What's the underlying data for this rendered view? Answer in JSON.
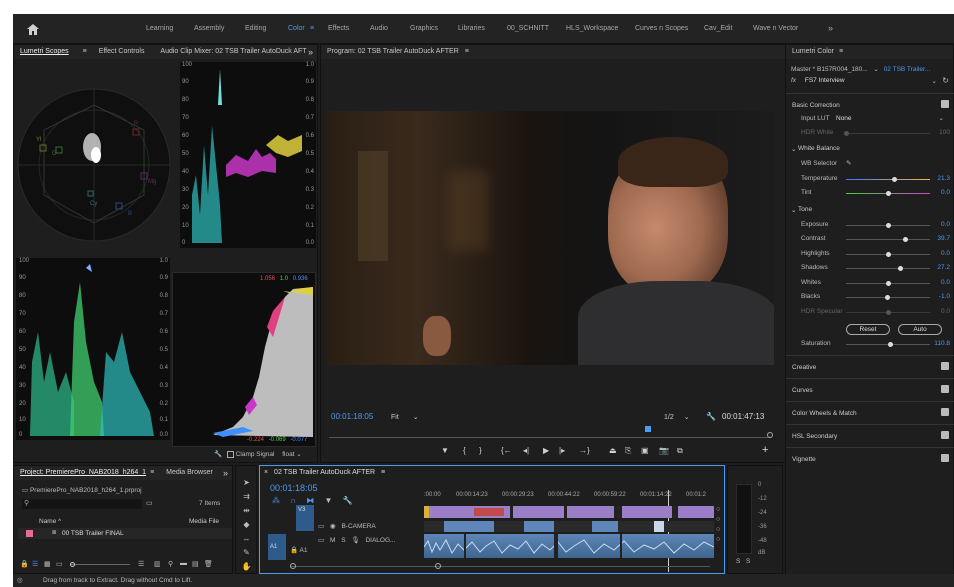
{
  "workspaces": [
    "Learning",
    "Assembly",
    "Editing",
    "Color",
    "Effects",
    "Audio",
    "Graphics",
    "Libraries",
    "00_SCHNITT",
    "HLS_Workspace",
    "Curves n Scopes",
    "Cav_Edit",
    "Wave n Vector"
  ],
  "active_workspace": "Color",
  "scopes_panel": {
    "tab_lumetri": "Lumetri Scopes",
    "tab_effect": "Effect Controls",
    "tab_mixer": "Audio Clip Mixer: 02 TSB Trailer AutoDuck AFT",
    "vector_labels": [
      "R",
      "Mg",
      "B",
      "Cy",
      "G",
      "Yl"
    ],
    "wave_ticks_left": [
      "100",
      "90",
      "80",
      "70",
      "60",
      "50",
      "40",
      "30",
      "20",
      "10",
      "0"
    ],
    "wave_ticks_right": [
      "1.0",
      "0.9",
      "0.8",
      "0.7",
      "0.6",
      "0.5",
      "0.4",
      "0.3",
      "0.2",
      "0.1",
      "0.0"
    ],
    "parade_ticks_left": [
      "100",
      "90",
      "80",
      "70",
      "60",
      "50",
      "40",
      "30",
      "20",
      "10",
      "0"
    ],
    "parade_ticks_right": [
      "1.0",
      "0.9",
      "0.8",
      "0.7",
      "0.6",
      "0.5",
      "0.4",
      "0.3",
      "0.2",
      "0.1",
      "0.0"
    ],
    "hist_top": [
      "1.056",
      "1.0",
      "0.936"
    ],
    "hist_bottom": [
      "-0.224",
      "-0.069",
      "-0.077"
    ],
    "clamp_label": "Clamp Signal",
    "float_label": "float"
  },
  "program": {
    "title": "Program: 02 TSB Trailer AutoDuck AFTER",
    "timecode": "00:01:18:05",
    "fit": "Fit",
    "resolution": "1/2",
    "duration": "00:01:47:13"
  },
  "lumetri": {
    "title": "Lumetri Color",
    "master": "Master * B157R004_180...",
    "clip": "02 TSB Trailer...",
    "fx": "fx",
    "preset": "FS7 Interview",
    "basic": "Basic Correction",
    "input_lut_label": "Input LUT",
    "input_lut_value": "None",
    "hdr_white_label": "HDR White",
    "hdr_white_value": "100",
    "white_balance": "White Balance",
    "wb_selector": "WB Selector",
    "temperature_label": "Temperature",
    "temperature_value": "21.3",
    "tint_label": "Tint",
    "tint_value": "0.0",
    "tone": "Tone",
    "exposure_label": "Exposure",
    "exposure_value": "0.0",
    "contrast_label": "Contrast",
    "contrast_value": "39.7",
    "highlights_label": "Highlights",
    "highlights_value": "0.0",
    "shadows_label": "Shadows",
    "shadows_value": "27.2",
    "whites_label": "Whites",
    "whites_value": "0.0",
    "blacks_label": "Blacks",
    "blacks_value": "-1.0",
    "hdr_specular_label": "HDR Specular",
    "hdr_specular_value": "0.0",
    "reset": "Reset",
    "auto": "Auto",
    "saturation_label": "Saturation",
    "saturation_value": "110.8",
    "sections": [
      "Creative",
      "Curves",
      "Color Wheels & Match",
      "HSL Secondary",
      "Vignette"
    ]
  },
  "project": {
    "tab": "Project: PremierePro_NAB2018_h264_1",
    "tab2": "Media Browser",
    "file": "PremierePro_NAB2018_h264_1.prproj",
    "items": "7 Items",
    "col_name": "Name",
    "col_media": "Media File",
    "row1": "00 TSB Trailer FINAL"
  },
  "timeline": {
    "title": "02 TSB Trailer AutoDuck AFTER",
    "timecode": "00:01:18:05",
    "ruler": [
      ":00:00",
      "00:00:14:23",
      "00:00:29:23",
      "00:00:44:22",
      "00:00:59:22",
      "00:01:14:22",
      "00:01:2"
    ],
    "v3": "V3",
    "v2_name": "B-CAMERA",
    "a1_name": "DIALOG...",
    "a1": "A1",
    "a1b": "A1",
    "m": "M",
    "s": "S"
  },
  "meter": {
    "ticks": [
      "0",
      "-12",
      "-24",
      "-36",
      "-48",
      "dB"
    ],
    "s1": "S",
    "s2": "S"
  },
  "status": "Drag from track to Extract. Drag without Cmd to Lift."
}
